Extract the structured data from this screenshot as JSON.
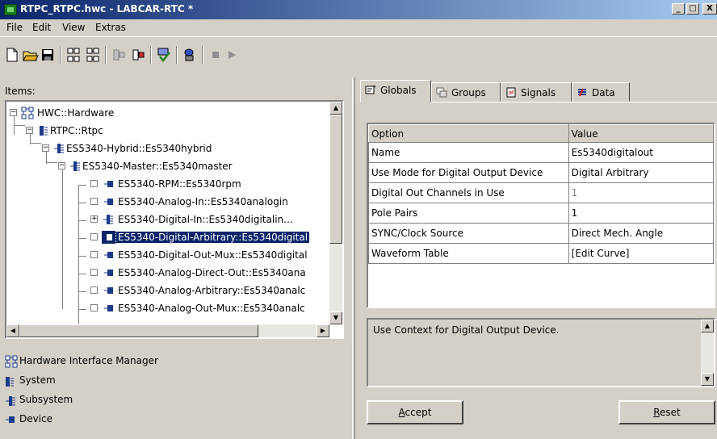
{
  "window": {
    "title": "RTPC_RTPC.hwc - LABCAR-RTC  *",
    "min": "_",
    "max": "□",
    "close": "X"
  },
  "menu": [
    "File",
    "Edit",
    "View",
    "Extras"
  ],
  "left": {
    "items_label": "Items:",
    "tree": [
      {
        "label": "HWC::Hardware",
        "expander": "−"
      },
      {
        "label": "RTPC::Rtpc",
        "expander": "−"
      },
      {
        "label": "ES5340-Hybrid::Es5340hybrid",
        "expander": "−"
      },
      {
        "label": "ES5340-Master::Es5340master",
        "expander": "−"
      },
      {
        "label": "ES5340-RPM::Es5340rpm",
        "expander": ""
      },
      {
        "label": "ES5340-Analog-In::Es5340analogin",
        "expander": ""
      },
      {
        "label": "ES5340-Digital-In::Es5340digitalin...",
        "expander": "+"
      },
      {
        "label": "ES5340-Digital-Arbitrary::Es5340digital",
        "expander": "",
        "selected": true
      },
      {
        "label": "ES5340-Digital-Out-Mux::Es5340digital",
        "expander": ""
      },
      {
        "label": "ES5340-Analog-Direct-Out::Es5340ana",
        "expander": ""
      },
      {
        "label": "ES5340-Analog-Arbitrary::Es5340analc",
        "expander": ""
      },
      {
        "label": "ES5340-Analog-Out-Mux::Es5340analc",
        "expander": ""
      }
    ],
    "legend": [
      {
        "label": "Hardware Interface Manager",
        "icon": "hardware-manager-icon"
      },
      {
        "label": "System",
        "icon": "system-icon"
      },
      {
        "label": "Subsystem",
        "icon": "subsystem-icon"
      },
      {
        "label": "Device",
        "icon": "device-icon"
      }
    ]
  },
  "right": {
    "tabs": [
      {
        "label": "Globals",
        "icon": "globals-icon",
        "active": true
      },
      {
        "label": "Groups",
        "icon": "groups-icon"
      },
      {
        "label": "Signals",
        "icon": "signals-icon"
      },
      {
        "label": "Data",
        "icon": "data-icon"
      }
    ],
    "table": {
      "headers": [
        "Option",
        "Value"
      ],
      "rows": [
        {
          "option": "Name",
          "value": "Es5340digitalout"
        },
        {
          "option": "Use Mode for Digital Output Device",
          "value": "Digital Arbitrary"
        },
        {
          "option": "Digital Out Channels in Use",
          "value": "1",
          "disabled": true
        },
        {
          "option": "Pole Pairs",
          "value": "1"
        },
        {
          "option": "SYNC/Clock Source",
          "value": "Direct Mech. Angle"
        },
        {
          "option": "Waveform Table",
          "value": "[Edit Curve]"
        }
      ]
    },
    "description": "Use Context for Digital Output Device.",
    "accept_mnemonic": "A",
    "accept_rest": "ccept",
    "reset_mnemonic": "R",
    "reset_rest": "eset"
  },
  "colors": {
    "titlebar_start": "#0a246a",
    "titlebar_end": "#a6caf0",
    "selection": "#0a246a",
    "face": "#d4d0c8"
  }
}
